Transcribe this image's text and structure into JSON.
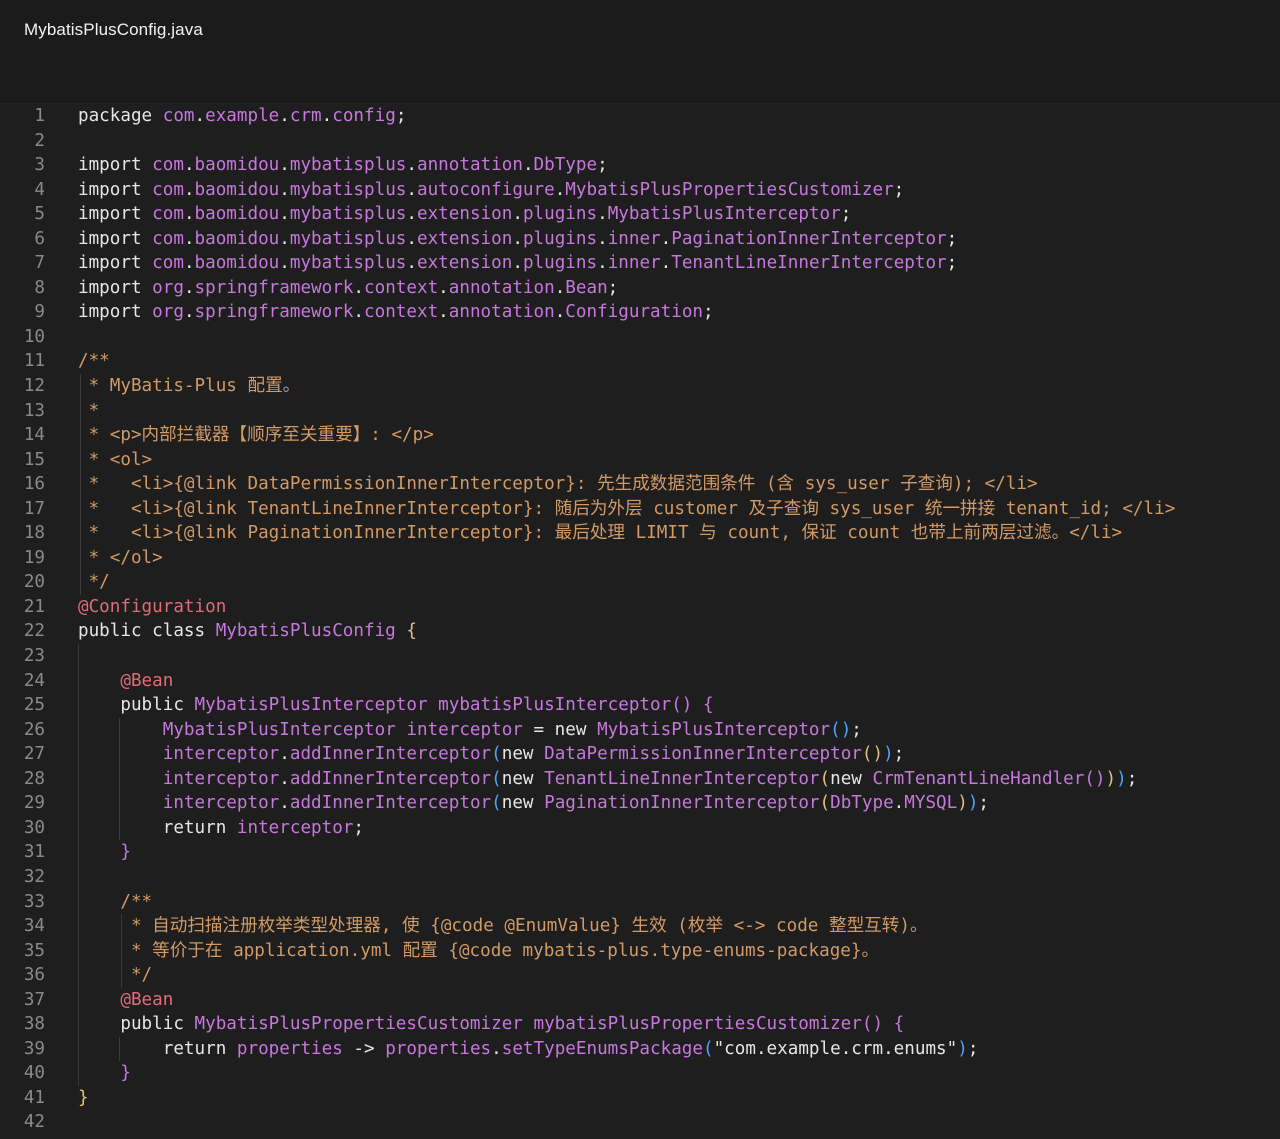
{
  "tab": {
    "title": "MybatisPlusConfig.java"
  },
  "editor": {
    "language": "java",
    "lines": [
      {
        "n": "1",
        "tokens": [
          {
            "t": "package ",
            "c": "kw"
          },
          {
            "t": "com",
            "c": "pk"
          },
          {
            "t": ".",
            "c": "pu"
          },
          {
            "t": "example",
            "c": "pk"
          },
          {
            "t": ".",
            "c": "pu"
          },
          {
            "t": "crm",
            "c": "pk"
          },
          {
            "t": ".",
            "c": "pu"
          },
          {
            "t": "config",
            "c": "pk"
          },
          {
            "t": ";",
            "c": "pu"
          }
        ]
      },
      {
        "n": "2",
        "tokens": []
      },
      {
        "n": "3",
        "tokens": [
          {
            "t": "import ",
            "c": "kw"
          },
          {
            "t": "com",
            "c": "pk"
          },
          {
            "t": ".",
            "c": "pu"
          },
          {
            "t": "baomidou",
            "c": "pk"
          },
          {
            "t": ".",
            "c": "pu"
          },
          {
            "t": "mybatisplus",
            "c": "pk"
          },
          {
            "t": ".",
            "c": "pu"
          },
          {
            "t": "annotation",
            "c": "pk"
          },
          {
            "t": ".",
            "c": "pu"
          },
          {
            "t": "DbType",
            "c": "ty"
          },
          {
            "t": ";",
            "c": "pu"
          }
        ]
      },
      {
        "n": "4",
        "tokens": [
          {
            "t": "import ",
            "c": "kw"
          },
          {
            "t": "com",
            "c": "pk"
          },
          {
            "t": ".",
            "c": "pu"
          },
          {
            "t": "baomidou",
            "c": "pk"
          },
          {
            "t": ".",
            "c": "pu"
          },
          {
            "t": "mybatisplus",
            "c": "pk"
          },
          {
            "t": ".",
            "c": "pu"
          },
          {
            "t": "autoconfigure",
            "c": "pk"
          },
          {
            "t": ".",
            "c": "pu"
          },
          {
            "t": "MybatisPlusPropertiesCustomizer",
            "c": "ty"
          },
          {
            "t": ";",
            "c": "pu"
          }
        ]
      },
      {
        "n": "5",
        "tokens": [
          {
            "t": "import ",
            "c": "kw"
          },
          {
            "t": "com",
            "c": "pk"
          },
          {
            "t": ".",
            "c": "pu"
          },
          {
            "t": "baomidou",
            "c": "pk"
          },
          {
            "t": ".",
            "c": "pu"
          },
          {
            "t": "mybatisplus",
            "c": "pk"
          },
          {
            "t": ".",
            "c": "pu"
          },
          {
            "t": "extension",
            "c": "pk"
          },
          {
            "t": ".",
            "c": "pu"
          },
          {
            "t": "plugins",
            "c": "pk"
          },
          {
            "t": ".",
            "c": "pu"
          },
          {
            "t": "MybatisPlusInterceptor",
            "c": "ty"
          },
          {
            "t": ";",
            "c": "pu"
          }
        ]
      },
      {
        "n": "6",
        "tokens": [
          {
            "t": "import ",
            "c": "kw"
          },
          {
            "t": "com",
            "c": "pk"
          },
          {
            "t": ".",
            "c": "pu"
          },
          {
            "t": "baomidou",
            "c": "pk"
          },
          {
            "t": ".",
            "c": "pu"
          },
          {
            "t": "mybatisplus",
            "c": "pk"
          },
          {
            "t": ".",
            "c": "pu"
          },
          {
            "t": "extension",
            "c": "pk"
          },
          {
            "t": ".",
            "c": "pu"
          },
          {
            "t": "plugins",
            "c": "pk"
          },
          {
            "t": ".",
            "c": "pu"
          },
          {
            "t": "inner",
            "c": "pk"
          },
          {
            "t": ".",
            "c": "pu"
          },
          {
            "t": "PaginationInnerInterceptor",
            "c": "ty"
          },
          {
            "t": ";",
            "c": "pu"
          }
        ]
      },
      {
        "n": "7",
        "tokens": [
          {
            "t": "import ",
            "c": "kw"
          },
          {
            "t": "com",
            "c": "pk"
          },
          {
            "t": ".",
            "c": "pu"
          },
          {
            "t": "baomidou",
            "c": "pk"
          },
          {
            "t": ".",
            "c": "pu"
          },
          {
            "t": "mybatisplus",
            "c": "pk"
          },
          {
            "t": ".",
            "c": "pu"
          },
          {
            "t": "extension",
            "c": "pk"
          },
          {
            "t": ".",
            "c": "pu"
          },
          {
            "t": "plugins",
            "c": "pk"
          },
          {
            "t": ".",
            "c": "pu"
          },
          {
            "t": "inner",
            "c": "pk"
          },
          {
            "t": ".",
            "c": "pu"
          },
          {
            "t": "TenantLineInnerInterceptor",
            "c": "ty"
          },
          {
            "t": ";",
            "c": "pu"
          }
        ]
      },
      {
        "n": "8",
        "tokens": [
          {
            "t": "import ",
            "c": "kw"
          },
          {
            "t": "org",
            "c": "pk"
          },
          {
            "t": ".",
            "c": "pu"
          },
          {
            "t": "springframework",
            "c": "pk"
          },
          {
            "t": ".",
            "c": "pu"
          },
          {
            "t": "context",
            "c": "pk"
          },
          {
            "t": ".",
            "c": "pu"
          },
          {
            "t": "annotation",
            "c": "pk"
          },
          {
            "t": ".",
            "c": "pu"
          },
          {
            "t": "Bean",
            "c": "ty"
          },
          {
            "t": ";",
            "c": "pu"
          }
        ]
      },
      {
        "n": "9",
        "tokens": [
          {
            "t": "import ",
            "c": "kw"
          },
          {
            "t": "org",
            "c": "pk"
          },
          {
            "t": ".",
            "c": "pu"
          },
          {
            "t": "springframework",
            "c": "pk"
          },
          {
            "t": ".",
            "c": "pu"
          },
          {
            "t": "context",
            "c": "pk"
          },
          {
            "t": ".",
            "c": "pu"
          },
          {
            "t": "annotation",
            "c": "pk"
          },
          {
            "t": ".",
            "c": "pu"
          },
          {
            "t": "Configuration",
            "c": "ty"
          },
          {
            "t": ";",
            "c": "pu"
          }
        ]
      },
      {
        "n": "10",
        "tokens": []
      },
      {
        "n": "11",
        "tokens": [
          {
            "t": "/**",
            "c": "cm"
          }
        ]
      },
      {
        "n": "12",
        "tokens": [
          {
            "t": " * MyBatis-Plus 配置。",
            "c": "cm"
          }
        ]
      },
      {
        "n": "13",
        "tokens": [
          {
            "t": " *",
            "c": "cm"
          }
        ]
      },
      {
        "n": "14",
        "tokens": [
          {
            "t": " * <p>内部拦截器【顺序至关重要】: </p>",
            "c": "cm"
          }
        ]
      },
      {
        "n": "15",
        "tokens": [
          {
            "t": " * <ol>",
            "c": "cm"
          }
        ]
      },
      {
        "n": "16",
        "tokens": [
          {
            "t": " *   <li>{@link DataPermissionInnerInterceptor}: 先生成数据范围条件 (含 sys_user 子查询); </li>",
            "c": "cm"
          }
        ]
      },
      {
        "n": "17",
        "tokens": [
          {
            "t": " *   <li>{@link TenantLineInnerInterceptor}: 随后为外层 customer 及子查询 sys_user 统一拼接 tenant_id; </li>",
            "c": "cm"
          }
        ]
      },
      {
        "n": "18",
        "tokens": [
          {
            "t": " *   <li>{@link PaginationInnerInterceptor}: 最后处理 LIMIT 与 count, 保证 count 也带上前两层过滤。</li>",
            "c": "cm"
          }
        ]
      },
      {
        "n": "19",
        "tokens": [
          {
            "t": " * </ol>",
            "c": "cm"
          }
        ]
      },
      {
        "n": "20",
        "tokens": [
          {
            "t": " */",
            "c": "cm"
          }
        ]
      },
      {
        "n": "21",
        "tokens": [
          {
            "t": "@Configuration",
            "c": "an"
          }
        ]
      },
      {
        "n": "22",
        "tokens": [
          {
            "t": "public class ",
            "c": "kw"
          },
          {
            "t": "MybatisPlusConfig ",
            "c": "ty"
          },
          {
            "t": "{",
            "c": "p1"
          }
        ]
      },
      {
        "n": "23",
        "tokens": []
      },
      {
        "n": "24",
        "tokens": [
          {
            "t": "    ",
            "c": "pu"
          },
          {
            "t": "@Bean",
            "c": "an"
          }
        ]
      },
      {
        "n": "25",
        "tokens": [
          {
            "t": "    public ",
            "c": "kw"
          },
          {
            "t": "MybatisPlusInterceptor ",
            "c": "ty"
          },
          {
            "t": "mybatisPlusInterceptor",
            "c": "id"
          },
          {
            "t": "() {",
            "c": "p2"
          }
        ]
      },
      {
        "n": "26",
        "tokens": [
          {
            "t": "        ",
            "c": "pu"
          },
          {
            "t": "MybatisPlusInterceptor ",
            "c": "ty"
          },
          {
            "t": "interceptor",
            "c": "id"
          },
          {
            "t": " = new ",
            "c": "kw"
          },
          {
            "t": "MybatisPlusInterceptor",
            "c": "ty"
          },
          {
            "t": "()",
            "c": "p3"
          },
          {
            "t": ";",
            "c": "pu"
          }
        ]
      },
      {
        "n": "27",
        "tokens": [
          {
            "t": "        ",
            "c": "pu"
          },
          {
            "t": "interceptor",
            "c": "id"
          },
          {
            "t": ".",
            "c": "pu"
          },
          {
            "t": "addInnerInterceptor",
            "c": "id"
          },
          {
            "t": "(",
            "c": "p3"
          },
          {
            "t": "new ",
            "c": "kw"
          },
          {
            "t": "DataPermissionInnerInterceptor",
            "c": "ty"
          },
          {
            "t": "()",
            "c": "p1"
          },
          {
            "t": ")",
            "c": "p3"
          },
          {
            "t": ";",
            "c": "pu"
          }
        ]
      },
      {
        "n": "28",
        "tokens": [
          {
            "t": "        ",
            "c": "pu"
          },
          {
            "t": "interceptor",
            "c": "id"
          },
          {
            "t": ".",
            "c": "pu"
          },
          {
            "t": "addInnerInterceptor",
            "c": "id"
          },
          {
            "t": "(",
            "c": "p3"
          },
          {
            "t": "new ",
            "c": "kw"
          },
          {
            "t": "TenantLineInnerInterceptor",
            "c": "ty"
          },
          {
            "t": "(",
            "c": "p1"
          },
          {
            "t": "new ",
            "c": "kw"
          },
          {
            "t": "CrmTenantLineHandler",
            "c": "ty"
          },
          {
            "t": "()",
            "c": "p2"
          },
          {
            "t": ")",
            "c": "p1"
          },
          {
            "t": ")",
            "c": "p3"
          },
          {
            "t": ";",
            "c": "pu"
          }
        ]
      },
      {
        "n": "29",
        "tokens": [
          {
            "t": "        ",
            "c": "pu"
          },
          {
            "t": "interceptor",
            "c": "id"
          },
          {
            "t": ".",
            "c": "pu"
          },
          {
            "t": "addInnerInterceptor",
            "c": "id"
          },
          {
            "t": "(",
            "c": "p3"
          },
          {
            "t": "new ",
            "c": "kw"
          },
          {
            "t": "PaginationInnerInterceptor",
            "c": "ty"
          },
          {
            "t": "(",
            "c": "p1"
          },
          {
            "t": "DbType",
            "c": "ty"
          },
          {
            "t": ".",
            "c": "pu"
          },
          {
            "t": "MYSQL",
            "c": "id"
          },
          {
            "t": ")",
            "c": "p1"
          },
          {
            "t": ")",
            "c": "p3"
          },
          {
            "t": ";",
            "c": "pu"
          }
        ]
      },
      {
        "n": "30",
        "tokens": [
          {
            "t": "        return ",
            "c": "kw"
          },
          {
            "t": "interceptor",
            "c": "id"
          },
          {
            "t": ";",
            "c": "pu"
          }
        ]
      },
      {
        "n": "31",
        "tokens": [
          {
            "t": "    ",
            "c": "pu"
          },
          {
            "t": "}",
            "c": "p2"
          }
        ]
      },
      {
        "n": "32",
        "tokens": []
      },
      {
        "n": "33",
        "tokens": [
          {
            "t": "    /**",
            "c": "cm"
          }
        ]
      },
      {
        "n": "34",
        "tokens": [
          {
            "t": "     * 自动扫描注册枚举类型处理器, 使 {@code @EnumValue} 生效 (枚举 <-> code 整型互转)。",
            "c": "cm"
          }
        ]
      },
      {
        "n": "35",
        "tokens": [
          {
            "t": "     * 等价于在 application.yml 配置 {@code mybatis-plus.type-enums-package}。",
            "c": "cm"
          }
        ]
      },
      {
        "n": "36",
        "tokens": [
          {
            "t": "     */",
            "c": "cm"
          }
        ]
      },
      {
        "n": "37",
        "tokens": [
          {
            "t": "    ",
            "c": "pu"
          },
          {
            "t": "@Bean",
            "c": "an"
          }
        ]
      },
      {
        "n": "38",
        "tokens": [
          {
            "t": "    public ",
            "c": "kw"
          },
          {
            "t": "MybatisPlusPropertiesCustomizer ",
            "c": "ty"
          },
          {
            "t": "mybatisPlusPropertiesCustomizer",
            "c": "id"
          },
          {
            "t": "() {",
            "c": "p2"
          }
        ]
      },
      {
        "n": "39",
        "tokens": [
          {
            "t": "        return ",
            "c": "kw"
          },
          {
            "t": "properties",
            "c": "id"
          },
          {
            "t": " -> ",
            "c": "kw"
          },
          {
            "t": "properties",
            "c": "id"
          },
          {
            "t": ".",
            "c": "pu"
          },
          {
            "t": "setTypeEnumsPackage",
            "c": "id"
          },
          {
            "t": "(",
            "c": "p3"
          },
          {
            "t": "\"com.example.crm.enums\"",
            "c": "kw"
          },
          {
            "t": ")",
            "c": "p3"
          },
          {
            "t": ";",
            "c": "pu"
          }
        ]
      },
      {
        "n": "40",
        "tokens": [
          {
            "t": "    ",
            "c": "pu"
          },
          {
            "t": "}",
            "c": "p2"
          }
        ]
      },
      {
        "n": "41",
        "tokens": [
          {
            "t": "}",
            "c": "p1"
          }
        ]
      },
      {
        "n": "42",
        "tokens": []
      }
    ]
  }
}
